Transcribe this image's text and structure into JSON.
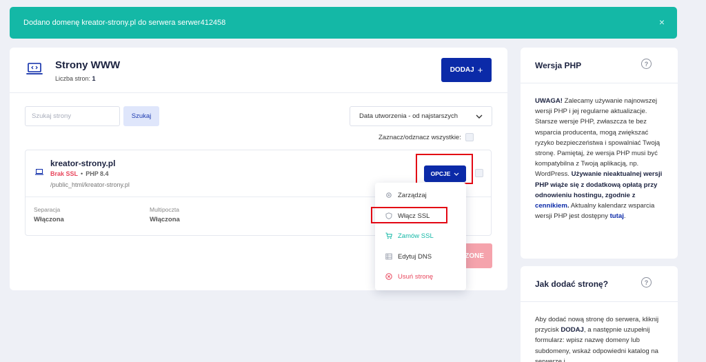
{
  "alert": {
    "message": "Dodano domenę kreator-strony.pl do serwera serwer412458",
    "close": "×"
  },
  "main": {
    "title": "Strony WWW",
    "count_label": "Liczba stron:",
    "count_value": "1",
    "add_button": "DODAJ",
    "add_plus": "+",
    "search_placeholder": "Szukaj strony",
    "search_button": "Szukaj",
    "sort_value": "Data utworzenia - od najstarszych",
    "select_all": "Zaznacz/odznacz wszystkie:",
    "delete_button_visible": "ZONE"
  },
  "site": {
    "name": "kreator-strony.pl",
    "ssl_status": "Brak SSL",
    "separator": "•",
    "php": "PHP 8.4",
    "path": "/public_html/kreator-strony.pl",
    "options_button": "OPCJE",
    "stats": [
      {
        "label": "Separacja",
        "value": "Włączona"
      },
      {
        "label": "Multipoczta",
        "value": "Włączona"
      }
    ]
  },
  "dropdown": {
    "items": [
      {
        "label": "Zarządzaj",
        "icon": "gear-icon",
        "color": "#333333"
      },
      {
        "label": "Włącz SSL",
        "icon": "shield-icon",
        "color": "#333333"
      },
      {
        "label": "Zamów SSL",
        "icon": "cart-icon",
        "color": "#14b8a6"
      },
      {
        "label": "Edytuj DNS",
        "icon": "list-icon",
        "color": "#333333"
      },
      {
        "label": "Usuń stronę",
        "icon": "close-circle-icon",
        "color": "#e8465c"
      }
    ]
  },
  "php_card": {
    "title": "Wersja PHP",
    "help": "?",
    "p1": "UWAGA!",
    "p2": " Zalecamy używanie najnowszej wersji PHP i jej regularne aktualizacje. Starsze wersje PHP, zwłaszcza te bez wsparcia producenta, mogą zwiększać ryzyko bezpieczeństwa i spowalniać Twoją stronę. Pamiętaj, że wersja PHP musi być kompatybilna z Twoją aplikacją, np. WordPress. ",
    "p3": "Używanie nieaktualnej wersji PHP wiąże się z dodatkową opłatą przy odnowieniu hostingu, zgodnie z ",
    "p4": "cennikiem",
    "p5": ".",
    "p6": " Aktualny kalendarz wsparcia wersji PHP jest dostępny ",
    "p7": "tutaj",
    "p8": "."
  },
  "howto_card": {
    "title": "Jak dodać stronę?",
    "help": "?",
    "p1": "Aby dodać nową stronę do serwera, kliknij przycisk ",
    "p2": "DODAJ",
    "p3": ", a następnie uzupełnij formularz: wpisz nazwę domeny lub subdomeny, wskaż odpowiedni katalog na serwerze i"
  },
  "colors": {
    "accent": "#0b2aa8",
    "success": "#14b8a6",
    "danger": "#e8465c",
    "highlight": "#e30613"
  }
}
